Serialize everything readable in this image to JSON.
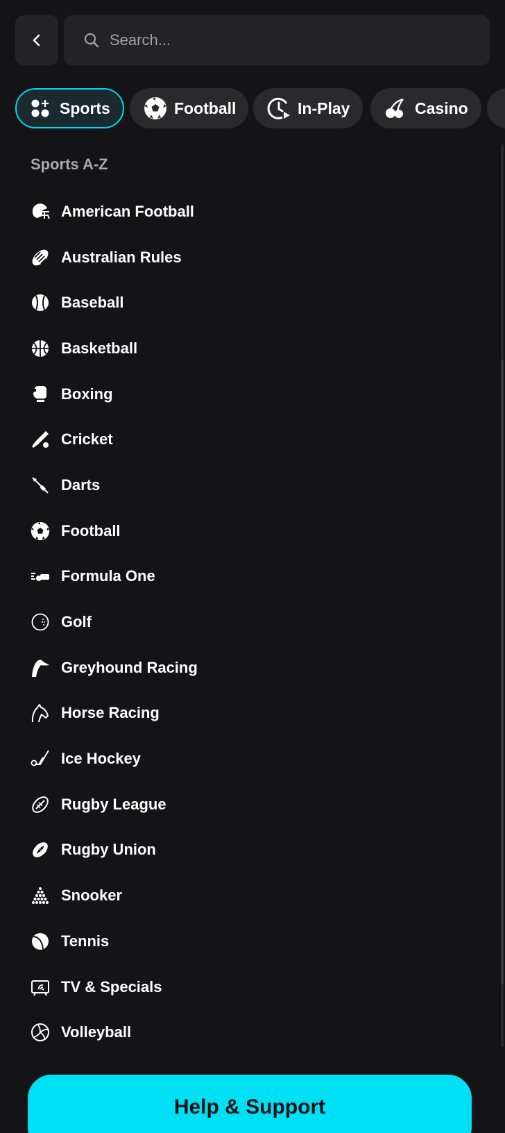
{
  "search": {
    "placeholder": "Search..."
  },
  "nav_chips": [
    {
      "label": "Sports",
      "icon": "sports-plus-icon",
      "active": true
    },
    {
      "label": "Football",
      "icon": "football-icon",
      "active": false
    },
    {
      "label": "In-Play",
      "icon": "clock-play-icon",
      "active": false
    },
    {
      "label": "Casino",
      "icon": "cherries-icon",
      "active": false
    }
  ],
  "section_title": "Sports A-Z",
  "sports": [
    {
      "label": "American Football",
      "icon": "american-football-helmet-icon"
    },
    {
      "label": "Australian Rules",
      "icon": "australian-rules-ball-icon"
    },
    {
      "label": "Baseball",
      "icon": "baseball-icon"
    },
    {
      "label": "Basketball",
      "icon": "basketball-icon"
    },
    {
      "label": "Boxing",
      "icon": "boxing-glove-icon"
    },
    {
      "label": "Cricket",
      "icon": "cricket-bat-icon"
    },
    {
      "label": "Darts",
      "icon": "dart-icon"
    },
    {
      "label": "Football",
      "icon": "football-icon"
    },
    {
      "label": "Formula One",
      "icon": "race-car-icon"
    },
    {
      "label": "Golf",
      "icon": "golf-ball-icon"
    },
    {
      "label": "Greyhound Racing",
      "icon": "greyhound-icon"
    },
    {
      "label": "Horse Racing",
      "icon": "horse-head-icon"
    },
    {
      "label": "Ice Hockey",
      "icon": "hockey-stick-icon"
    },
    {
      "label": "Rugby League",
      "icon": "rugby-ball-icon"
    },
    {
      "label": "Rugby Union",
      "icon": "rugby-ball-laced-icon"
    },
    {
      "label": "Snooker",
      "icon": "snooker-balls-icon"
    },
    {
      "label": "Tennis",
      "icon": "tennis-ball-icon"
    },
    {
      "label": "TV & Specials",
      "icon": "tv-icon"
    },
    {
      "label": "Volleyball",
      "icon": "volleyball-icon"
    }
  ],
  "help_button": {
    "label": "Help & Support"
  },
  "colors": {
    "background": "#141416",
    "surface": "#232326",
    "accent": "#00e0f5",
    "muted_text": "#a8a8ad"
  }
}
